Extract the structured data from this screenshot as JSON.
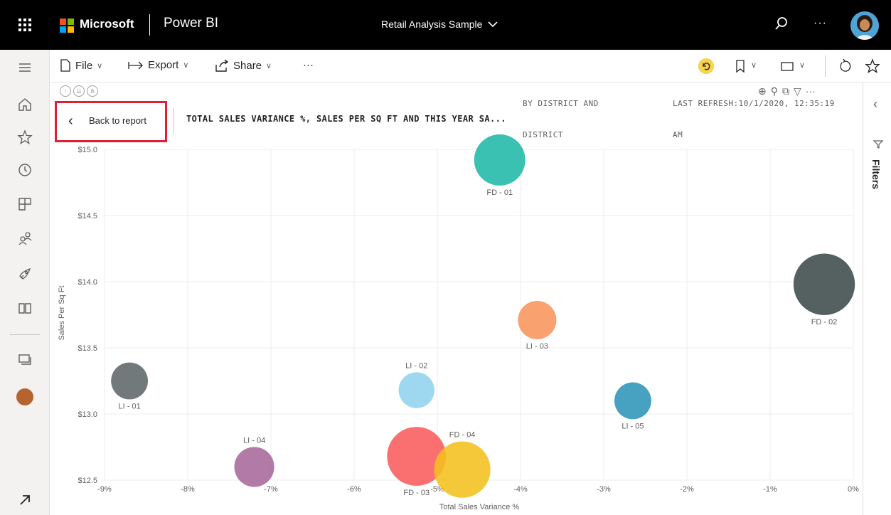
{
  "header": {
    "brand": "Microsoft",
    "app": "Power BI",
    "report_title": "Retail Analysis Sample",
    "more": "···"
  },
  "toolbar": {
    "file": "File",
    "export": "Export",
    "share": "Share",
    "more": "···"
  },
  "visual": {
    "back_label": "Back to report",
    "title": "TOTAL SALES VARIANCE %, SALES PER SQ FT AND THIS YEAR SA...",
    "cut_top_left": "BY DISTRICT AND",
    "cut_top_right": "LAST REFRESH:10/1/2020, 12:35:19",
    "cut_bottom_left": "DISTRICT",
    "cut_bottom_right": "AM"
  },
  "filters": {
    "label": "Filters"
  },
  "chart_data": {
    "type": "scatter",
    "xlabel": "Total Sales Variance %",
    "ylabel": "Sales Per Sq Ft",
    "xlim": [
      -9,
      0
    ],
    "ylim": [
      12.5,
      15.0
    ],
    "x_ticks": [
      "-9%",
      "-8%",
      "-7%",
      "-6%",
      "-5%",
      "-4%",
      "-3%",
      "-2%",
      "-1%",
      "0%"
    ],
    "y_ticks": [
      "$12.5",
      "$13.0",
      "$13.5",
      "$14.0",
      "$14.5",
      "$15.0"
    ],
    "grid": true,
    "points": [
      {
        "label": "FD - 01",
        "x": -4.25,
        "y": 14.92,
        "size": 1.0,
        "color": "#1fb8a6"
      },
      {
        "label": "FD - 02",
        "x": -0.35,
        "y": 13.98,
        "size": 1.2,
        "color": "#3e4a4a"
      },
      {
        "label": "LI - 03",
        "x": -3.8,
        "y": 13.71,
        "size": 0.75,
        "color": "#f9945c"
      },
      {
        "label": "LI - 01",
        "x": -8.7,
        "y": 13.25,
        "size": 0.72,
        "color": "#5f6769"
      },
      {
        "label": "LI - 02",
        "x": -5.25,
        "y": 13.18,
        "size": 0.7,
        "color": "#8fd3ee"
      },
      {
        "label": "LI - 05",
        "x": -2.65,
        "y": 13.1,
        "size": 0.72,
        "color": "#2d94b8"
      },
      {
        "label": "LI - 04",
        "x": -7.2,
        "y": 12.6,
        "size": 0.78,
        "color": "#a7689a"
      },
      {
        "label": "FD - 03",
        "x": -5.25,
        "y": 12.68,
        "size": 1.15,
        "color": "#f95c5c"
      },
      {
        "label": "FD - 04",
        "x": -4.7,
        "y": 12.58,
        "size": 1.1,
        "color": "#f4c01f"
      }
    ]
  }
}
